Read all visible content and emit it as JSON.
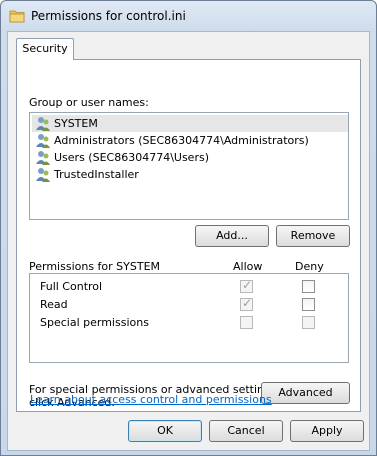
{
  "window": {
    "title": "Permissions for control.ini"
  },
  "tabs": [
    {
      "label": "Security",
      "active": true
    }
  ],
  "users": {
    "label": "Group or user names:",
    "items": [
      {
        "name": "SYSTEM",
        "selected": true
      },
      {
        "name": "Administrators (SEC86304774\\Administrators)",
        "selected": false
      },
      {
        "name": "Users (SEC86304774\\Users)",
        "selected": false
      },
      {
        "name": "TrustedInstaller",
        "selected": false
      }
    ],
    "add_label": "Add...",
    "remove_label": "Remove"
  },
  "permissions": {
    "header": "Permissions for SYSTEM",
    "allow_header": "Allow",
    "deny_header": "Deny",
    "rows": [
      {
        "name": "Full Control",
        "allow": true,
        "deny": false
      },
      {
        "name": "Read",
        "allow": true,
        "deny": false
      },
      {
        "name": "Special permissions",
        "allow": false,
        "deny": false
      }
    ]
  },
  "advanced": {
    "text_line1": "For special permissions or advanced settings,",
    "text_line2": "click Advanced.",
    "button_label": "Advanced"
  },
  "learn_link": "Learn about access control and permissions",
  "footer": {
    "ok_label": "OK",
    "cancel_label": "Cancel",
    "apply_label": "Apply"
  },
  "colors": {
    "link": "#0066cc",
    "selection": "#e6e6e6"
  }
}
